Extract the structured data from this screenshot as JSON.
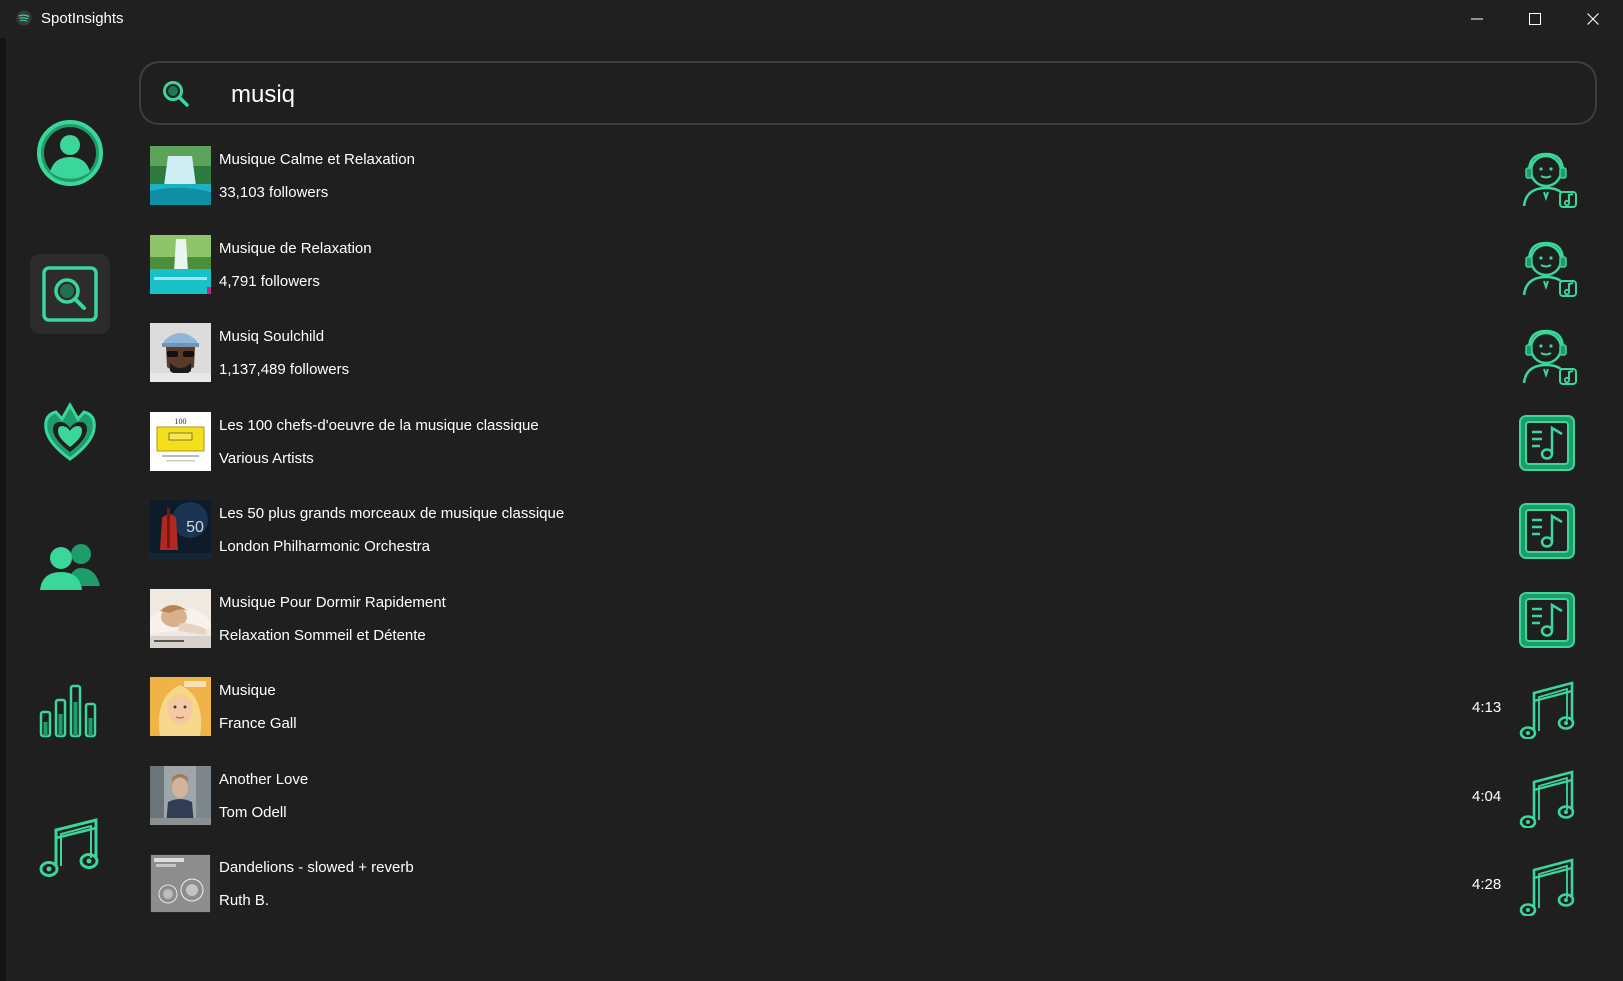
{
  "window": {
    "title": "SpotInsights",
    "controls": [
      "minimize-icon",
      "maximize-icon",
      "close-icon"
    ]
  },
  "theme": {
    "accent": "#3ad69a",
    "accent_dark": "#1f9c6c",
    "background": "#1f1f1f"
  },
  "sidebar": {
    "items": [
      {
        "name": "profile",
        "icon": "user-circle-icon",
        "active": false
      },
      {
        "name": "search",
        "icon": "search-square-icon",
        "active": true
      },
      {
        "name": "favorites",
        "icon": "heart-crown-icon",
        "active": false
      },
      {
        "name": "friends",
        "icon": "users-icon",
        "active": false
      },
      {
        "name": "stats",
        "icon": "bar-chart-icon",
        "active": false
      },
      {
        "name": "tracks",
        "icon": "music-note-icon",
        "active": false
      }
    ]
  },
  "search": {
    "value": "musiq",
    "icon": "search-icon"
  },
  "results": [
    {
      "title": "Musique Calme et Relaxation",
      "subtitle": "33,103 followers",
      "duration": "",
      "type": "artist",
      "icon": "artist-headphones-icon",
      "thumb": "waterfall-art"
    },
    {
      "title": "Musique de Relaxation",
      "subtitle": "4,791 followers",
      "duration": "",
      "type": "artist",
      "icon": "artist-headphones-icon",
      "thumb": "nature-art"
    },
    {
      "title": "Musiq Soulchild",
      "subtitle": "1,137,489 followers",
      "duration": "",
      "type": "artist",
      "icon": "artist-headphones-icon",
      "thumb": "portrait-cap"
    },
    {
      "title": "Les 100 chefs-d'oeuvre de la musique classique",
      "subtitle": "Various Artists",
      "duration": "",
      "type": "album",
      "icon": "album-note-icon",
      "thumb": "yellow-label"
    },
    {
      "title": "Les 50 plus grands morceaux de musique classique",
      "subtitle": "London Philharmonic Orchestra",
      "duration": "",
      "type": "album",
      "icon": "album-note-icon",
      "thumb": "dark-cello"
    },
    {
      "title": "Musique Pour Dormir Rapidement",
      "subtitle": "Relaxation Sommeil et Détente",
      "duration": "",
      "type": "album",
      "icon": "album-note-icon",
      "thumb": "sleeping-woman"
    },
    {
      "title": "Musique",
      "subtitle": "France Gall",
      "duration": "4:13",
      "type": "track",
      "icon": "music-note-icon",
      "thumb": "blonde-portrait"
    },
    {
      "title": "Another Love",
      "subtitle": "Tom Odell",
      "duration": "4:04",
      "type": "track",
      "icon": "music-note-icon",
      "thumb": "street-portrait"
    },
    {
      "title": "Dandelions - slowed + reverb",
      "subtitle": "Ruth B.",
      "duration": "4:28",
      "type": "track",
      "icon": "music-note-icon",
      "thumb": "dandelion-grey"
    }
  ]
}
